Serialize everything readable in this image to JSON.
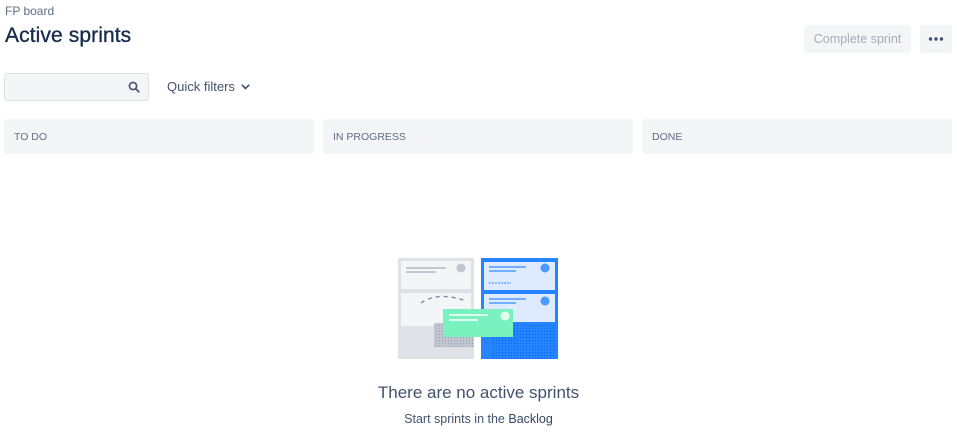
{
  "header": {
    "breadcrumb": "FP board",
    "title": "Active sprints",
    "complete_sprint_label": "Complete sprint",
    "more_icon": "more-horizontal-icon"
  },
  "toolbar": {
    "search_placeholder": "",
    "search_icon": "search-icon",
    "quick_filters_label": "Quick filters",
    "quick_filters_icon": "chevron-down-icon"
  },
  "columns": [
    {
      "label": "TO DO"
    },
    {
      "label": "IN PROGRESS"
    },
    {
      "label": "DONE"
    }
  ],
  "empty_state": {
    "title": "There are no active sprints",
    "subtitle_prefix": "Start sprints in the ",
    "subtitle_link": "Backlog"
  },
  "colors": {
    "accent_blue": "#2684ff",
    "card_green": "#79f2c0",
    "disabled_text": "#a5adba",
    "column_bg": "#f4f5f7"
  }
}
